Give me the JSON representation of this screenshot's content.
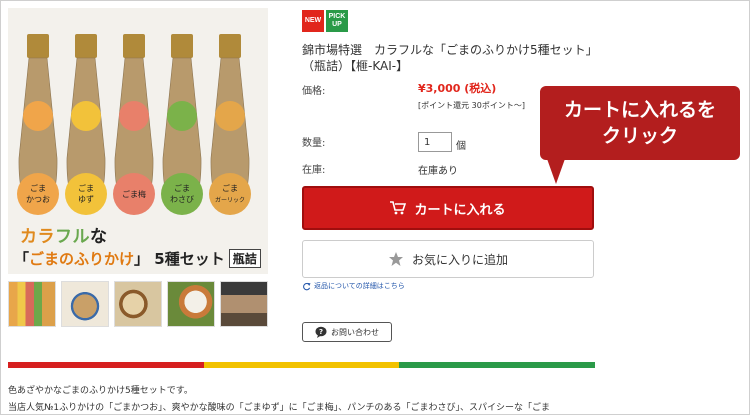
{
  "badges": {
    "new": "NEW",
    "pick_line1": "PICK",
    "pick_line2": "UP"
  },
  "product": {
    "title": "錦市場特選　カラフルな「ごまのふりかけ5種セット」（瓶詰）【榧-KAI-】",
    "price_label": "価格:",
    "price": "¥3,000 (税込)",
    "points": "[ポイント還元 30ポイント〜]",
    "qty_label": "数量:",
    "qty_value": "1",
    "qty_unit": "個",
    "stock_label": "在庫:",
    "stock_value": "在庫あり"
  },
  "image_banner": {
    "line1_a": "カラ",
    "line1_b": "フル",
    "line1_c": "な",
    "line2_a": "「",
    "line2_b": "ごまのふりかけ",
    "line2_c": "」 5種セット",
    "tag": "瓶詰",
    "bottles": [
      {
        "label1": "ごま",
        "label2": "かつお",
        "tag_color": "#f0a54a"
      },
      {
        "label1": "ごま",
        "label2": "ゆず",
        "tag_color": "#f2c23a"
      },
      {
        "label1": "ごま梅",
        "label2": "",
        "tag_color": "#e8806a"
      },
      {
        "label1": "ごま",
        "label2": "わさび",
        "tag_color": "#7bb24a"
      },
      {
        "label1": "ごま",
        "label2": "ガーリック",
        "tag_color": "#e4a64a"
      }
    ]
  },
  "buttons": {
    "cart": "カートに入れる",
    "favorite": "お気に入りに追加",
    "inquiry": "お問い合わせ"
  },
  "links": {
    "return_policy": "返品についての詳細はこちら"
  },
  "callout": {
    "line1": "カートに入れるを",
    "line2": "クリック"
  },
  "stripe_colors": [
    "#d61f1f",
    "#f2c200",
    "#2a9a48"
  ],
  "description": {
    "line1": "色あざやかなごまのふりかけ5種セットです。",
    "line2": "当店人気№1ふりかけの「ごまかつお」、爽やかな酸味の「ごまゆず」に「ごま梅」、パンチのある「ごまわさび」、スパイシーな「ごま"
  },
  "icons": {
    "cart": "cart-icon",
    "star": "star-icon",
    "refresh": "return-icon",
    "speech": "inquiry-icon"
  }
}
